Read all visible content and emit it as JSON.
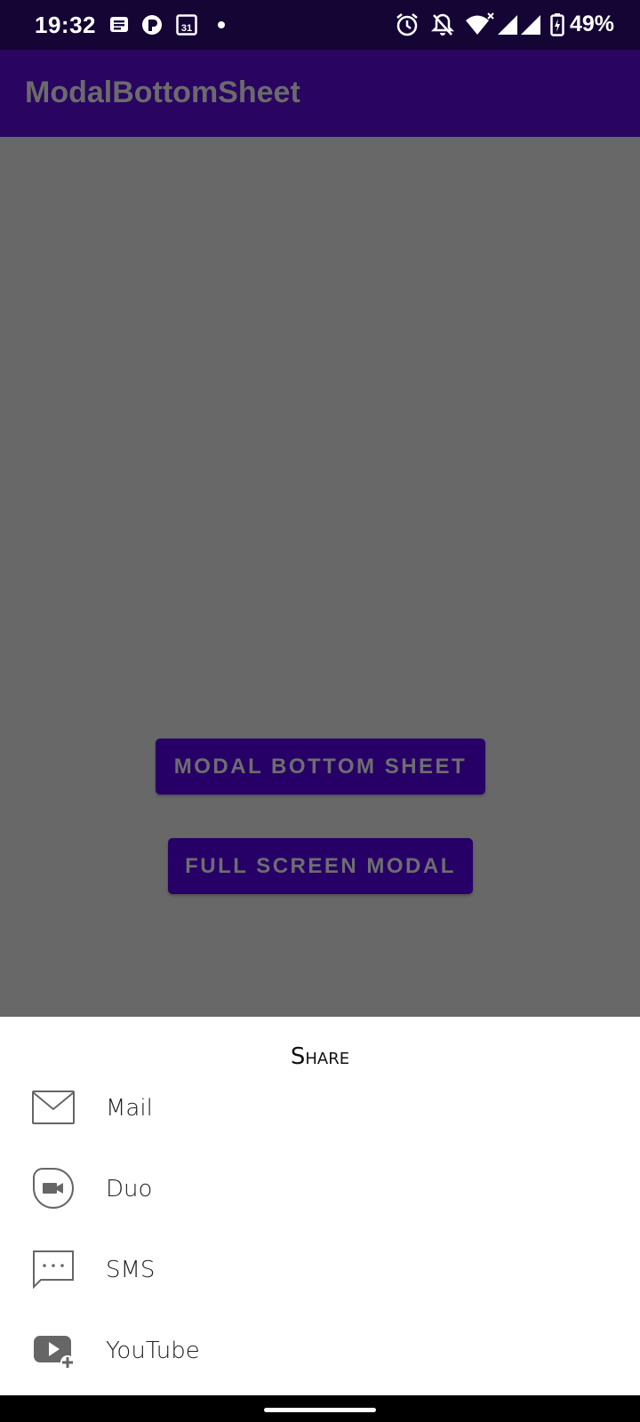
{
  "status_bar": {
    "time": "19:32",
    "battery": "49%",
    "icons": [
      "messages-icon",
      "app-notification-icon",
      "calendar-icon",
      "dot-icon",
      "alarm-icon",
      "bell-off-icon",
      "wifi-icon",
      "signal-icon",
      "signal-icon",
      "battery-icon"
    ],
    "calendar_day": "31"
  },
  "app_bar": {
    "title": "ModalBottomSheet"
  },
  "content": {
    "modal_button_label": "MODAL BOTTOM SHEET",
    "fullscreen_button_label": "FULL SCREEN MODAL"
  },
  "sheet": {
    "title": "Share",
    "items": [
      {
        "label": "Mail",
        "icon": "mail-icon"
      },
      {
        "label": "Duo",
        "icon": "duo-icon"
      },
      {
        "label": "SMS",
        "icon": "sms-icon"
      },
      {
        "label": "YouTube",
        "icon": "youtube-icon"
      }
    ]
  },
  "colors": {
    "status_bar": "#140534",
    "app_bar": "#290461",
    "scrim": "#686868",
    "button": "#270067",
    "sheet": "#ffffff"
  }
}
